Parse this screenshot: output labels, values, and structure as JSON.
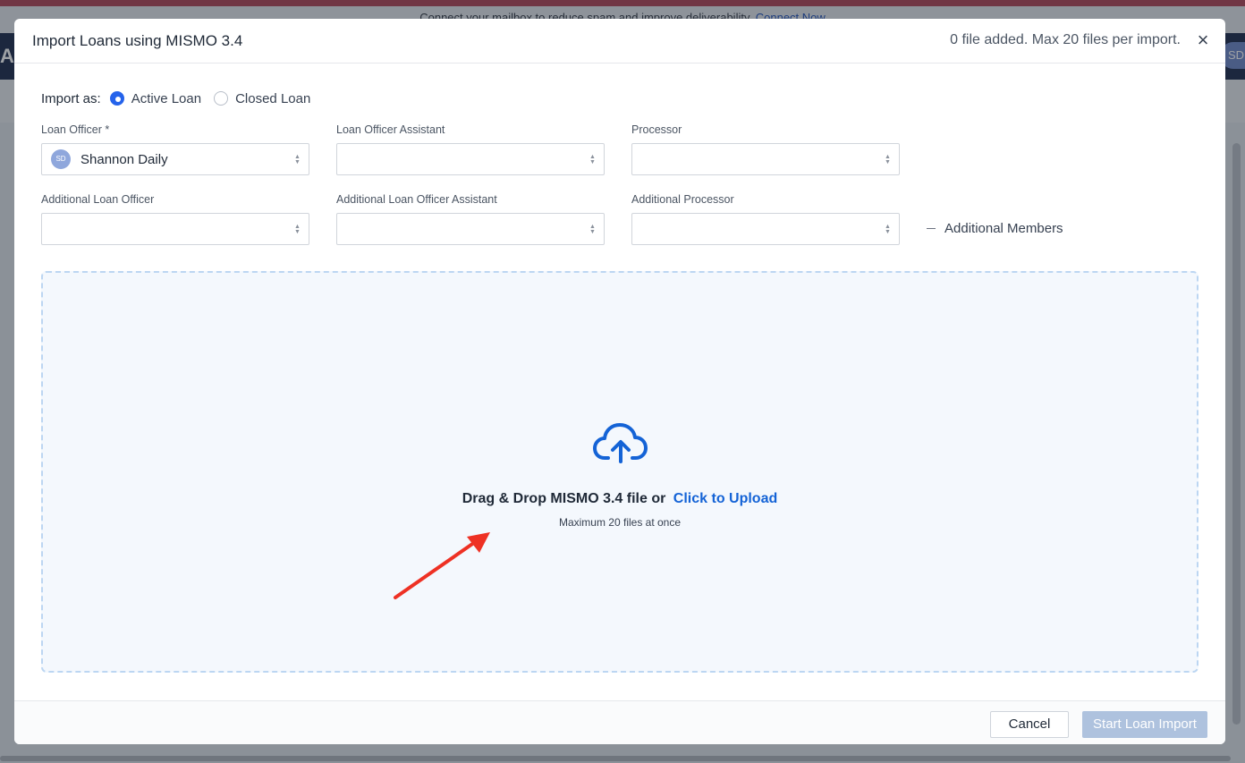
{
  "background": {
    "banner_text": "Connect your mailbox to reduce spam and improve deliverability.",
    "banner_link": "Connect Now",
    "logo_letter": "A",
    "avatar_initials": "SD"
  },
  "modal": {
    "title": "Import Loans using MISMO 3.4",
    "file_status": "0 file added. Max 20 files per import.",
    "close_glyph": "×"
  },
  "import_as": {
    "label": "Import as:",
    "options": [
      {
        "label": "Active Loan",
        "selected": true
      },
      {
        "label": "Closed Loan",
        "selected": false
      }
    ]
  },
  "fields": {
    "loan_officer": {
      "label": "Loan Officer *",
      "value": "Shannon Daily",
      "avatar": "SD"
    },
    "loan_officer_assistant": {
      "label": "Loan Officer Assistant",
      "value": ""
    },
    "processor": {
      "label": "Processor",
      "value": ""
    },
    "additional_loan_officer": {
      "label": "Additional Loan Officer",
      "value": ""
    },
    "additional_loan_officer_assistant": {
      "label": "Additional Loan Officer Assistant",
      "value": ""
    },
    "additional_processor": {
      "label": "Additional Processor",
      "value": ""
    }
  },
  "additional_members": {
    "label": "Additional Members"
  },
  "dropzone": {
    "text": "Drag & Drop MISMO 3.4 file or",
    "link": "Click to Upload",
    "sub": "Maximum 20 files at once",
    "icon": "cloud-upload-icon"
  },
  "footer": {
    "cancel": "Cancel",
    "start": "Start Loan Import"
  },
  "colors": {
    "accent": "#2563eb",
    "link": "#1463d6",
    "dropzone_border": "#bcd6f2",
    "dropzone_bg": "#f4f8fd",
    "annotation_arrow": "#ee3124",
    "disabled_button": "#aec2de"
  }
}
